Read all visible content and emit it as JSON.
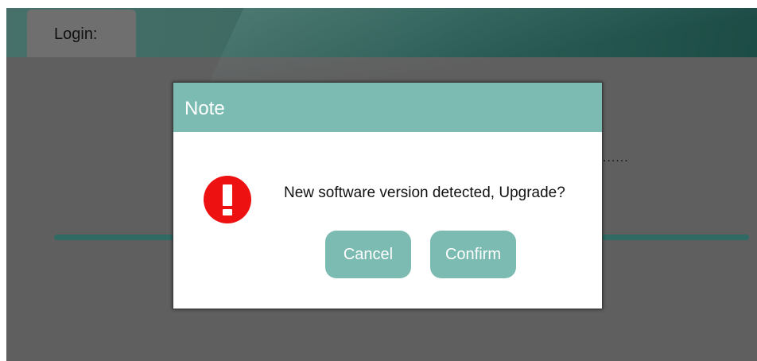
{
  "header": {
    "tab_label": "Login:"
  },
  "background": {
    "status_text": "......"
  },
  "dialog": {
    "title": "Note",
    "icon": "exclamation-icon",
    "message": "New software version detected, Upgrade?",
    "cancel_label": "Cancel",
    "confirm_label": "Confirm"
  },
  "colors": {
    "dialog_header": "#7bbbb1",
    "button": "#7bbbb1",
    "warning": "#ee1111",
    "overlay": "#5f5f5f",
    "progress": "#2f6a64"
  }
}
